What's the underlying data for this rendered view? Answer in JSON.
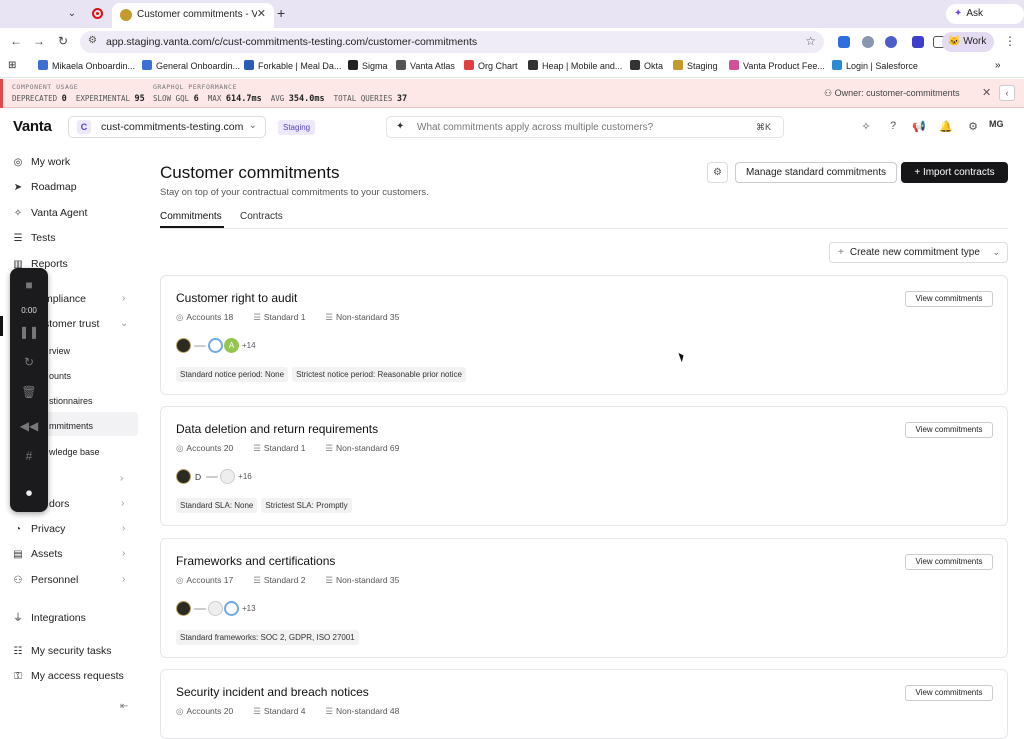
{
  "browser": {
    "tab_title": "Customer commitments - Va",
    "ask_gemini": "Ask Gemini",
    "url": "app.staging.vanta.com/c/cust-commitments-testing.com/customer-commitments",
    "profile": "Work",
    "bookmarks": [
      "Mikaela Onboardin...",
      "General Onboardin...",
      "Forkable | Meal Da...",
      "Sigma",
      "Vanta Atlas",
      "Org Chart",
      "Heap | Mobile and...",
      "Okta",
      "Staging",
      "Vanta Product Fee...",
      "Login | Salesforce"
    ],
    "bookmark_colors": [
      "#3b6fd4",
      "#3b6fd4",
      "#2b5bb8",
      "#222",
      "#555",
      "#e04040",
      "#333",
      "#333",
      "#c49a2c",
      "#d44e9b",
      "#2b8bd4"
    ]
  },
  "dev_banner": {
    "component_usage_title": "COMPONENT USAGE",
    "deprecated_label": "DEPRECATED",
    "deprecated_value": "0",
    "experimental_label": "EXPERIMENTAL",
    "experimental_value": "95",
    "graphql_title": "GRAPHQL PERFORMANCE",
    "slow_label": "SLOW GQL",
    "slow_value": "6",
    "max_label": "MAX",
    "max_value": "614.7ms",
    "avg_label": "AVG",
    "avg_value": "354.0ms",
    "total_label": "TOTAL QUERIES",
    "total_value": "37",
    "owner": "Owner: customer-commitments"
  },
  "header": {
    "logo": "Vanta",
    "workspace_initial": "C",
    "workspace_name": "cust-commitments-testing.com",
    "env_badge": "Staging",
    "search_placeholder": "What commitments apply across multiple customers?",
    "search_shortcut": "⌘K",
    "avatar_initials": "MG"
  },
  "sidebar": {
    "items": [
      {
        "label": "My work",
        "icon": "check-circle-icon"
      },
      {
        "label": "Roadmap",
        "icon": "roadmap-icon"
      },
      {
        "label": "Vanta Agent",
        "icon": "sparkle-icon"
      },
      {
        "label": "Tests",
        "icon": "list-icon"
      },
      {
        "label": "Reports",
        "icon": "chart-icon"
      },
      {
        "label": "mpliance",
        "icon": "compliance-icon"
      },
      {
        "label": "stomer trust",
        "icon": "trust-icon"
      }
    ],
    "subitems": [
      "rview",
      "ounts",
      "stionnaires",
      "mmitments",
      "wledge base"
    ],
    "lower_items": [
      {
        "label": "dors",
        "icon": "vendors-icon"
      },
      {
        "label": "Privacy",
        "icon": "privacy-icon"
      },
      {
        "label": "Assets",
        "icon": "assets-icon"
      },
      {
        "label": "Personnel",
        "icon": "personnel-icon"
      },
      {
        "label": "Integrations",
        "icon": "plug-icon"
      },
      {
        "label": "My security tasks",
        "icon": "tasks-icon"
      },
      {
        "label": "My access requests",
        "icon": "access-icon"
      }
    ]
  },
  "recorder": {
    "time": "0:00"
  },
  "main": {
    "title": "Customer commitments",
    "subtitle": "Stay on top of your contractual commitments to your customers.",
    "manage_button": "Manage standard commitments",
    "import_button": "Import contracts",
    "tabs": [
      "Commitments",
      "Contracts"
    ],
    "create_button": "Create new commitment type",
    "cards": [
      {
        "title": "Customer right to audit",
        "accounts": "Accounts 18",
        "standard": "Standard 1",
        "nonstandard": "Non-standard 35",
        "more": "+14",
        "letter": "",
        "chips": [
          "Standard notice period: None",
          "Strictest notice period: Reasonable prior notice"
        ],
        "button": "View commitments"
      },
      {
        "title": "Data deletion and return requirements",
        "accounts": "Accounts 20",
        "standard": "Standard 1",
        "nonstandard": "Non-standard 69",
        "more": "+16",
        "letter": "D",
        "chips": [
          "Standard SLA: None",
          "Strictest SLA: Promptly"
        ],
        "button": "View commitments"
      },
      {
        "title": "Frameworks and certifications",
        "accounts": "Accounts 17",
        "standard": "Standard 2",
        "nonstandard": "Non-standard 35",
        "more": "+13",
        "letter": "",
        "chips": [
          "Standard frameworks: SOC 2, GDPR, ISO 27001"
        ],
        "button": "View commitments"
      },
      {
        "title": "Security incident and breach notices",
        "accounts": "Accounts 20",
        "standard": "Standard 4",
        "nonstandard": "Non-standard 48",
        "more": "",
        "letter": "",
        "chips": [],
        "button": "View commitments"
      }
    ]
  }
}
